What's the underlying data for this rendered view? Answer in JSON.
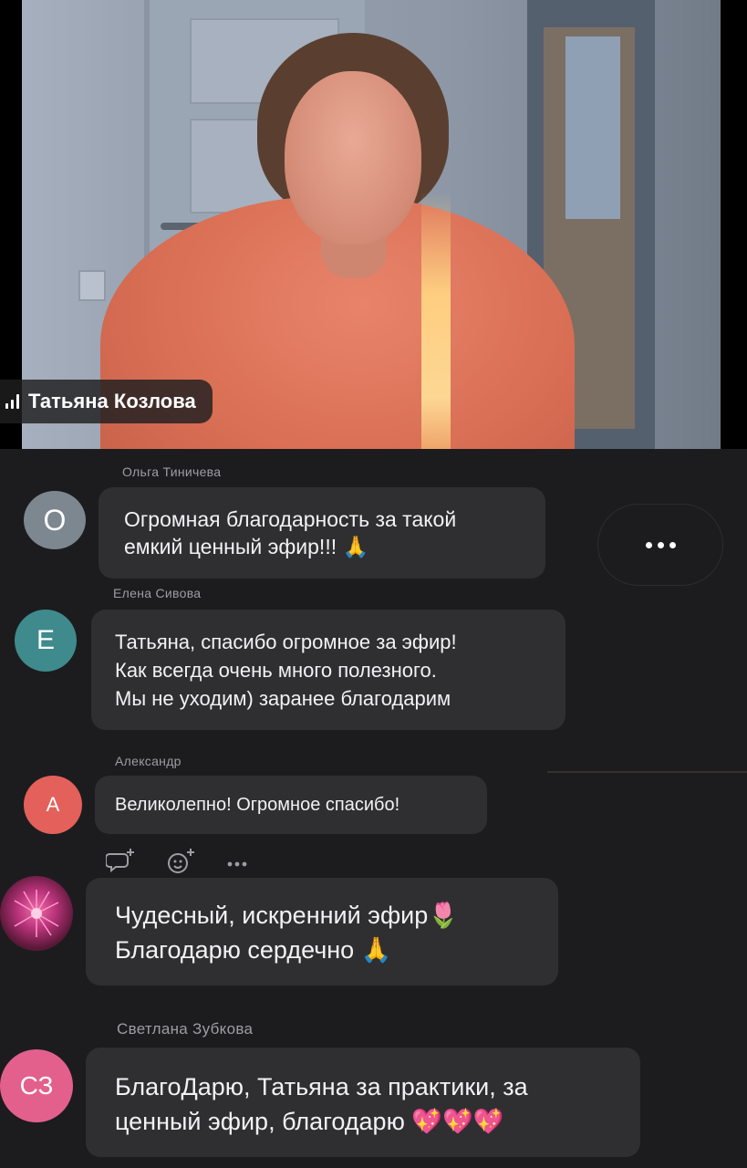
{
  "video": {
    "speaker_name": "Татьяна Козлова"
  },
  "chat": {
    "messages": [
      {
        "sender": "Ольга Тиничева",
        "avatar_letter": "О",
        "avatar_color": "#7d8790",
        "text": "Огромная благодарность за такой\nемкий ценный эфир!!!",
        "emoji": "🙏"
      },
      {
        "sender": "Елена Сивова",
        "avatar_letter": "Е",
        "avatar_color": "#3f8a8c",
        "text": "Татьяна, спасибо огромное за эфир!\nКак всегда очень много полезного.\nМы не уходим) заранее благодарим",
        "emoji": ""
      },
      {
        "sender": "Александр",
        "avatar_letter": "А",
        "avatar_color": "#e3615a",
        "text": "Великолепно! Огромное спасибо!",
        "emoji": ""
      },
      {
        "sender": "",
        "avatar_letter": "",
        "avatar_color": "#7a2450",
        "text": "Чудесный, искренний эфир🌷\nБлагодарю сердечно",
        "emoji": "🙏"
      },
      {
        "sender": "Светлана Зубкова",
        "avatar_letter": "СЗ",
        "avatar_color": "#e3608d",
        "text": "БлагоДарю, Татьяна за практики, за\nценный эфир, благодарю",
        "emoji": "💖💖💖"
      }
    ]
  },
  "icons": {
    "reply": "reply-plus-icon",
    "react": "add-reaction-icon",
    "more": "more-dots-icon"
  }
}
